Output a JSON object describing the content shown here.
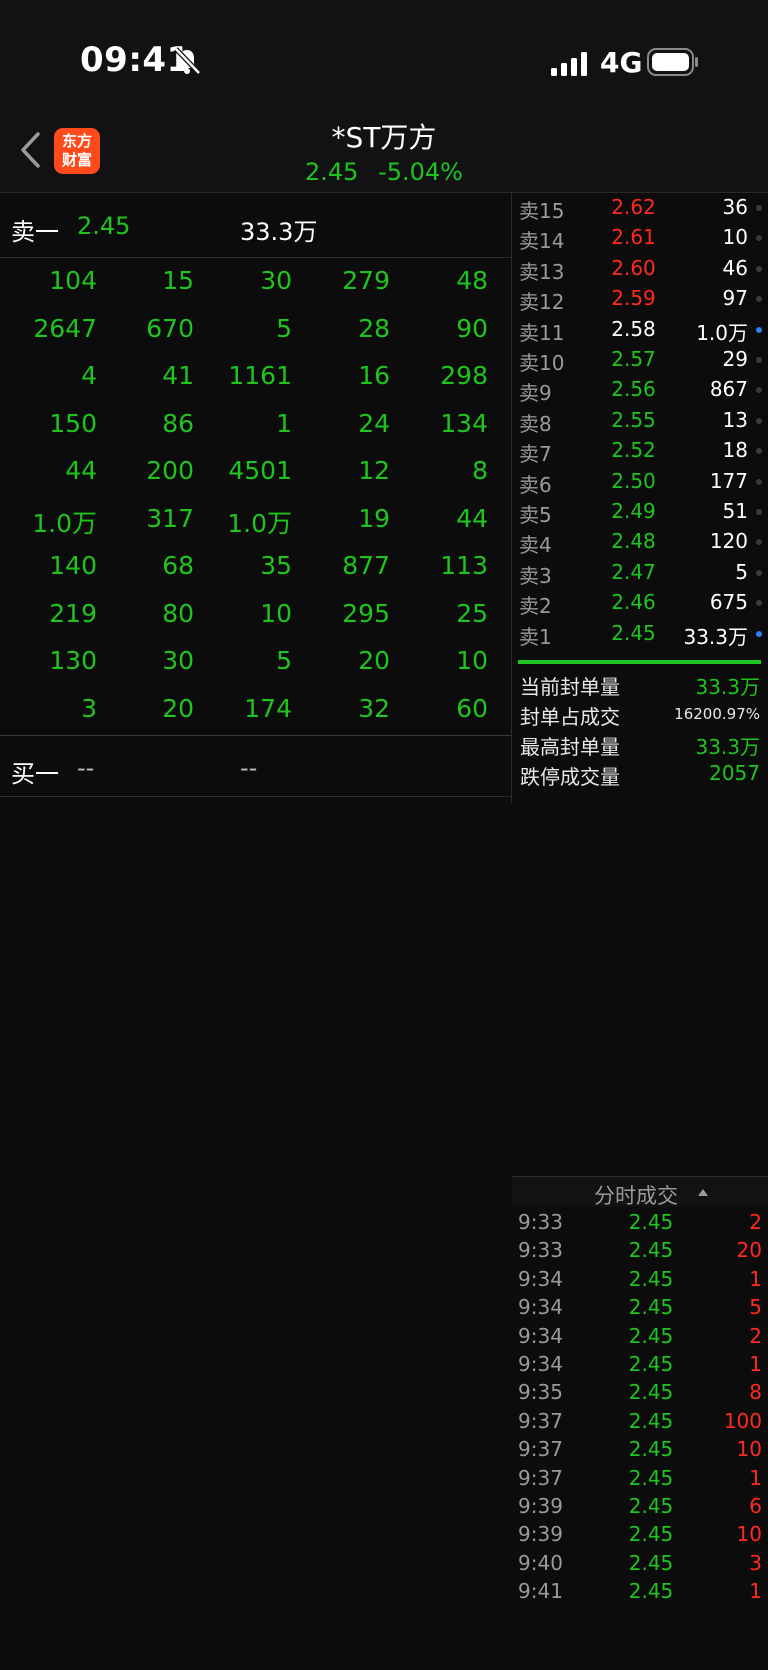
{
  "status": {
    "time": "09:41",
    "network": "4G"
  },
  "header": {
    "logo_line1": "东方",
    "logo_line2": "财富",
    "name": "*ST万方",
    "price": "2.45",
    "change": "-5.04%"
  },
  "left": {
    "sell1": {
      "label": "卖一",
      "price": "2.45",
      "volume": "33.3万"
    },
    "grid": [
      [
        "104",
        "15",
        "30",
        "279",
        "48"
      ],
      [
        "2647",
        "670",
        "5",
        "28",
        "90"
      ],
      [
        "4",
        "41",
        "1161",
        "16",
        "298"
      ],
      [
        "150",
        "86",
        "1",
        "24",
        "134"
      ],
      [
        "44",
        "200",
        "4501",
        "12",
        "8"
      ],
      [
        "1.0万",
        "317",
        "1.0万",
        "19",
        "44"
      ],
      [
        "140",
        "68",
        "35",
        "877",
        "113"
      ],
      [
        "219",
        "80",
        "10",
        "295",
        "25"
      ],
      [
        "130",
        "30",
        "5",
        "20",
        "10"
      ],
      [
        "3",
        "20",
        "174",
        "32",
        "60"
      ]
    ],
    "buy1": {
      "label": "买一",
      "price": "--",
      "volume": "--"
    }
  },
  "book": [
    {
      "label": "卖15",
      "price": "2.62",
      "volume": "36",
      "price_color": "red",
      "dot": "gray"
    },
    {
      "label": "卖14",
      "price": "2.61",
      "volume": "10",
      "price_color": "red",
      "dot": "gray"
    },
    {
      "label": "卖13",
      "price": "2.60",
      "volume": "46",
      "price_color": "red",
      "dot": "gray"
    },
    {
      "label": "卖12",
      "price": "2.59",
      "volume": "97",
      "price_color": "red",
      "dot": "gray"
    },
    {
      "label": "卖11",
      "price": "2.58",
      "volume": "1.0万",
      "price_color": "white",
      "dot": "blue"
    },
    {
      "label": "卖10",
      "price": "2.57",
      "volume": "29",
      "price_color": "green",
      "dot": "gray"
    },
    {
      "label": "卖9",
      "price": "2.56",
      "volume": "867",
      "price_color": "green",
      "dot": "gray"
    },
    {
      "label": "卖8",
      "price": "2.55",
      "volume": "13",
      "price_color": "green",
      "dot": "gray"
    },
    {
      "label": "卖7",
      "price": "2.52",
      "volume": "18",
      "price_color": "green",
      "dot": "gray"
    },
    {
      "label": "卖6",
      "price": "2.50",
      "volume": "177",
      "price_color": "green",
      "dot": "gray"
    },
    {
      "label": "卖5",
      "price": "2.49",
      "volume": "51",
      "price_color": "green",
      "dot": "gray"
    },
    {
      "label": "卖4",
      "price": "2.48",
      "volume": "120",
      "price_color": "green",
      "dot": "gray"
    },
    {
      "label": "卖3",
      "price": "2.47",
      "volume": "5",
      "price_color": "green",
      "dot": "gray"
    },
    {
      "label": "卖2",
      "price": "2.46",
      "volume": "675",
      "price_color": "green",
      "dot": "gray"
    },
    {
      "label": "卖1",
      "price": "2.45",
      "volume": "33.3万",
      "price_color": "green",
      "dot": "blue"
    }
  ],
  "stats": [
    {
      "label": "当前封单量",
      "value": "33.3万"
    },
    {
      "label": "封单占成交",
      "value": "16200.97%"
    },
    {
      "label": "最高封单量",
      "value": "33.3万"
    },
    {
      "label": "跌停成交量",
      "value": "2057"
    }
  ],
  "ticks": {
    "title": "分时成交",
    "rows": [
      {
        "time": "9:33",
        "price": "2.45",
        "volume": "2"
      },
      {
        "time": "9:33",
        "price": "2.45",
        "volume": "20"
      },
      {
        "time": "9:34",
        "price": "2.45",
        "volume": "1"
      },
      {
        "time": "9:34",
        "price": "2.45",
        "volume": "5"
      },
      {
        "time": "9:34",
        "price": "2.45",
        "volume": "2"
      },
      {
        "time": "9:34",
        "price": "2.45",
        "volume": "1"
      },
      {
        "time": "9:35",
        "price": "2.45",
        "volume": "8"
      },
      {
        "time": "9:37",
        "price": "2.45",
        "volume": "100"
      },
      {
        "time": "9:37",
        "price": "2.45",
        "volume": "10"
      },
      {
        "time": "9:37",
        "price": "2.45",
        "volume": "1"
      },
      {
        "time": "9:39",
        "price": "2.45",
        "volume": "6"
      },
      {
        "time": "9:39",
        "price": "2.45",
        "volume": "10"
      },
      {
        "time": "9:40",
        "price": "2.45",
        "volume": "3"
      },
      {
        "time": "9:41",
        "price": "2.45",
        "volume": "1"
      }
    ]
  }
}
